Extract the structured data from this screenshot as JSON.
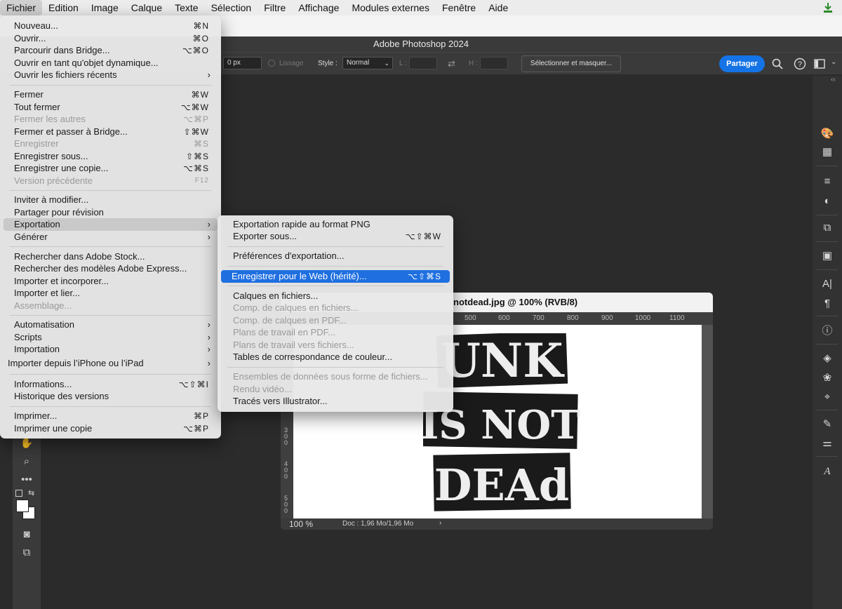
{
  "menubar": {
    "items": [
      "Fichier",
      "Edition",
      "Image",
      "Calque",
      "Texte",
      "Sélection",
      "Filtre",
      "Affichage",
      "Modules externes",
      "Fenêtre",
      "Aide"
    ],
    "download_icon": "download-icon"
  },
  "app": {
    "window_title": "Adobe Photoshop 2024"
  },
  "options_bar": {
    "feather_value": "0 px",
    "smoothing_label": "Lissage",
    "style_label": "Style :",
    "style_value": "Normal",
    "width_label": "L :",
    "height_label": "H :",
    "select_mask_label": "Sélectionner et masquer...",
    "share_label": "Partager"
  },
  "file_menu": {
    "items": [
      {
        "label": "Nouveau...",
        "shortcut": "⌘N"
      },
      {
        "label": "Ouvrir...",
        "shortcut": "⌘O"
      },
      {
        "label": "Parcourir dans Bridge...",
        "shortcut": "⌥⌘O"
      },
      {
        "label": "Ouvrir en tant qu'objet dynamique...",
        "shortcut": ""
      },
      {
        "label": "Ouvrir les fichiers récents",
        "shortcut": "›"
      },
      {
        "label": "Fermer",
        "shortcut": "⌘W"
      },
      {
        "label": "Tout fermer",
        "shortcut": "⌥⌘W"
      },
      {
        "label": "Fermer les autres",
        "shortcut": "⌥⌘P"
      },
      {
        "label": "Fermer et passer à Bridge...",
        "shortcut": "⇧⌘W"
      },
      {
        "label": "Enregistrer",
        "shortcut": "⌘S"
      },
      {
        "label": "Enregistrer sous...",
        "shortcut": "⇧⌘S"
      },
      {
        "label": "Enregistrer une copie...",
        "shortcut": "⌥⌘S"
      },
      {
        "label": "Version précédente",
        "shortcut": "F12"
      },
      {
        "label": "Inviter à modifier...",
        "shortcut": ""
      },
      {
        "label": "Partager pour révision",
        "shortcut": ""
      },
      {
        "label": "Exportation",
        "shortcut": "›"
      },
      {
        "label": "Générer",
        "shortcut": "›"
      },
      {
        "label": "Rechercher dans Adobe Stock...",
        "shortcut": ""
      },
      {
        "label": "Rechercher des modèles Adobe Express...",
        "shortcut": ""
      },
      {
        "label": "Importer et incorporer...",
        "shortcut": ""
      },
      {
        "label": "Importer et lier...",
        "shortcut": ""
      },
      {
        "label": "Assemblage...",
        "shortcut": ""
      },
      {
        "label": "Automatisation",
        "shortcut": "›"
      },
      {
        "label": "Scripts",
        "shortcut": "›"
      },
      {
        "label": "Importation",
        "shortcut": "›"
      },
      {
        "label": "Importer depuis l’iPhone ou l’iPad",
        "shortcut": "›"
      },
      {
        "label": "Informations...",
        "shortcut": "⌥⇧⌘I"
      },
      {
        "label": "Historique des versions",
        "shortcut": ""
      },
      {
        "label": "Imprimer...",
        "shortcut": "⌘P"
      },
      {
        "label": "Imprimer une copie",
        "shortcut": "⌥⌘P"
      }
    ]
  },
  "export_submenu": {
    "items": [
      {
        "label": "Exportation rapide au format PNG",
        "shortcut": ""
      },
      {
        "label": "Exporter sous...",
        "shortcut": "⌥⇧⌘W"
      },
      {
        "label": "Préférences d'exportation...",
        "shortcut": ""
      },
      {
        "label": "Enregistrer pour le Web (hérité)...",
        "shortcut": "⌥⇧⌘S"
      },
      {
        "label": "Calques en fichiers...",
        "shortcut": ""
      },
      {
        "label": "Comp. de calques en fichiers...",
        "shortcut": ""
      },
      {
        "label": "Comp. de calques en PDF...",
        "shortcut": ""
      },
      {
        "label": "Plans de travail en PDF...",
        "shortcut": ""
      },
      {
        "label": "Plans de travail vers fichiers...",
        "shortcut": ""
      },
      {
        "label": "Tables de correspondance de couleur...",
        "shortcut": ""
      },
      {
        "label": "Ensembles de données sous forme de fichiers...",
        "shortcut": ""
      },
      {
        "label": "Rendu vidéo...",
        "shortcut": ""
      },
      {
        "label": "Tracés vers Illustrator...",
        "shortcut": ""
      }
    ]
  },
  "document": {
    "title": "notdead.jpg @ 100% (RVB/8)",
    "ruler_ticks": [
      "500",
      "600",
      "700",
      "800",
      "900",
      "1000",
      "1100"
    ],
    "vruler_ticks": [
      "3 0 0",
      "4 0 0",
      "5 0 0"
    ],
    "zoom": "100 %",
    "doc_info": "Doc : 1,96 Mo/1,96 Mo",
    "artwork_lines": [
      "UNK",
      "IS NOT",
      "DEAd"
    ]
  },
  "colors": {
    "accent_blue": "#1f6fe0",
    "share_blue": "#1473e6",
    "app_bg": "#2b2b2b"
  }
}
